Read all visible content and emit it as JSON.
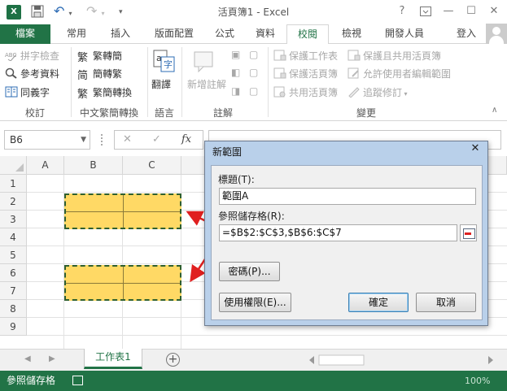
{
  "titlebar": {
    "app_icon_text": "X",
    "title": "活頁簿1 - Excel",
    "help": "?",
    "icons": [
      "excel-app-icon",
      "save-icon",
      "undo-icon",
      "redo-icon",
      "help-icon",
      "ribbon-display-icon",
      "minimize-icon",
      "maximize-icon",
      "close-icon"
    ]
  },
  "tabs": {
    "file": "檔案",
    "home": "常用",
    "insert": "插入",
    "layout": "版面配置",
    "formulas": "公式",
    "data": "資料",
    "review": "校閱",
    "view": "檢視",
    "developer": "開發人員",
    "signin": "登入"
  },
  "ribbon": {
    "proofing": {
      "spelling": "拼字檢查",
      "research": "參考資料",
      "thesaurus": "同義字",
      "label": "校訂"
    },
    "chinese": {
      "to_traditional": "繁轉簡",
      "to_simplified": "簡轉繁",
      "convert": "繁簡轉換",
      "label": "中文繁簡轉換"
    },
    "language": {
      "translate": "翻譯",
      "label": "語言"
    },
    "comments": {
      "new_comment": "新增註解",
      "label": "註解"
    },
    "changes": {
      "protect_sheet": "保護工作表",
      "protect_workbook": "保護活頁簿",
      "share_workbook": "共用活頁簿",
      "protect_share": "保護且共用活頁簿",
      "allow_edit_ranges": "允許使用者編輯範圍",
      "track_changes": "追蹤修訂",
      "label": "變更"
    },
    "accent": "#217346"
  },
  "formula_bar": {
    "name_box": "B6",
    "cancel": "✕",
    "enter": "✓",
    "fx": "fx",
    "formula": ""
  },
  "sheet": {
    "columns": [
      "A",
      "B",
      "C"
    ],
    "rows": [
      "1",
      "2",
      "3",
      "4",
      "5",
      "6",
      "7",
      "8",
      "9"
    ],
    "highlight_color": "#ffd965"
  },
  "sheetbar": {
    "tab": "工作表1",
    "add": "+"
  },
  "status": {
    "text": "參照儲存格",
    "zoom": "100%"
  },
  "dialog": {
    "title": "新範圍",
    "close": "✕",
    "title_label": "標題(T):",
    "title_value": "範圍A",
    "ref_label": "參照儲存格(R):",
    "ref_value": "=$B$2:$C$3,$B$6:$C$7",
    "password_btn": "密碼(P)...",
    "permissions_btn": "使用權限(E)...",
    "ok_btn": "確定",
    "cancel_btn": "取消",
    "arrow_color": "#e02020"
  }
}
